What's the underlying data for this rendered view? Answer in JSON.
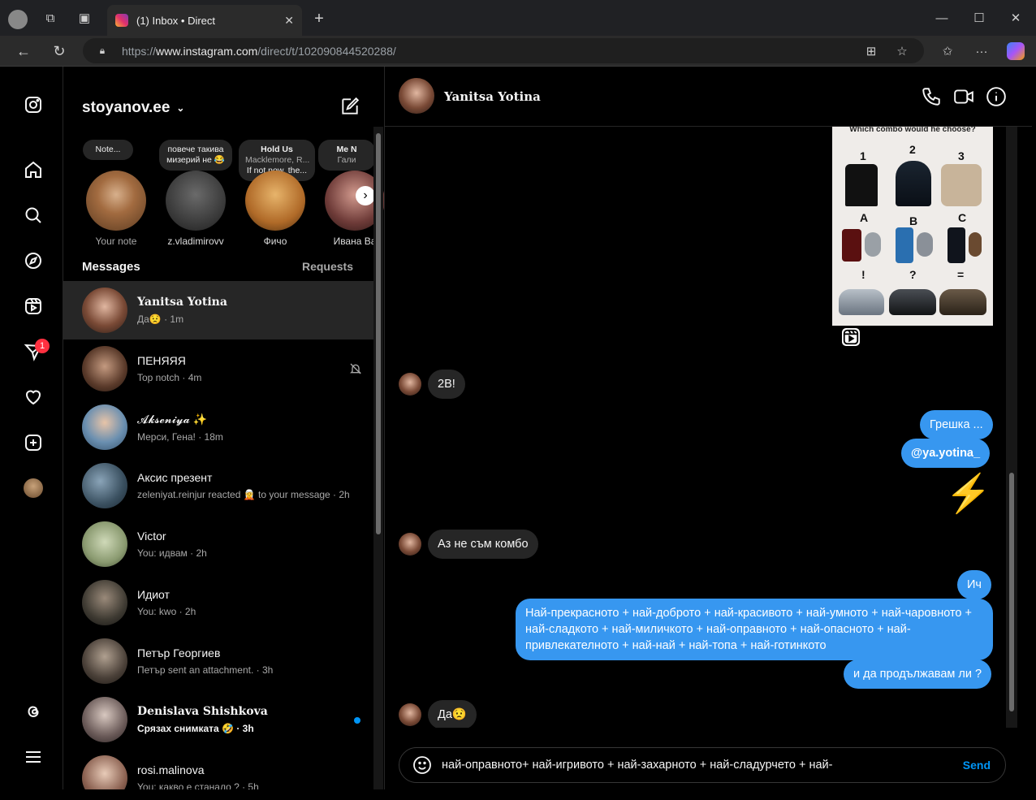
{
  "browser": {
    "tab_title": "(1) Inbox • Direct",
    "url_prefix": "https://",
    "url_host": "www.instagram.com",
    "url_path": "/direct/t/102090844520288/"
  },
  "rail": {
    "notification_badge": "1"
  },
  "inbox": {
    "account": "stoyanov.ee",
    "notes": [
      {
        "bubble": "Note...",
        "name": "Your note"
      },
      {
        "bubble": "повече такива мизерий не 😂",
        "name": "z.vladimirovv"
      },
      {
        "bubble": "Hold Us If not now, the...",
        "song": "Hold Us",
        "artist": "Macklemore, R...",
        "text": "If not now, the...",
        "name": "Фичо"
      },
      {
        "bubble": "Me N Гали",
        "song": "Me N",
        "artist": "Гали",
        "name": "Ивана Ва"
      }
    ],
    "messages_label": "Messages",
    "requests_label": "Requests",
    "conversations": [
      {
        "name": "Yanitsa Yotina",
        "preview": "Да😟 · 1m"
      },
      {
        "name": "ПЕНЯЯЯ",
        "preview": "Top notch · 4m"
      },
      {
        "name": "𝓐𝓴𝓼𝓮𝓷𝓲𝔂𝓪 ✨",
        "preview": "Мерси, Гена! · 18m"
      },
      {
        "name": "Аксис презент",
        "preview": "zeleniyat.reinjur reacted 🧝 to your message · 2h"
      },
      {
        "name": "Victor",
        "preview": "You: идвам · 2h"
      },
      {
        "name": "Идиот",
        "preview": "You: kwo · 2h"
      },
      {
        "name": "Петър Георгиев",
        "preview": "Петър sent an attachment. · 3h"
      },
      {
        "name": "Denislava Shishkova",
        "preview": "Срязах снимката 🤣 · 3h"
      },
      {
        "name": "rosi.malinova",
        "preview": "You: какво е станало ? · 5h"
      }
    ]
  },
  "chat": {
    "contact_name": "Yanitsa Yotina",
    "image_caption": "Which combo would he choose?",
    "image_labels": [
      "1",
      "2",
      "3",
      "A",
      "B",
      "C",
      "!",
      "?",
      "="
    ],
    "messages": [
      {
        "from": "them",
        "text": "2B!"
      },
      {
        "from": "me",
        "text": "Грешка ..."
      },
      {
        "from": "me",
        "text": "@ya.yotina_"
      },
      {
        "from": "me",
        "text": "⚡"
      },
      {
        "from": "them",
        "text": "Аз не съм комбо"
      },
      {
        "from": "me",
        "text": "Ич"
      },
      {
        "from": "me",
        "text": "Най-прекрасното + най-доброто + най-красивото + най-умното + най-чаровното + най-сладкото + най-миличкото + най-оправното + най-опасното + най-привлекателното + най-най + най-топа + най-готинкото"
      },
      {
        "from": "me",
        "text": "и да продължавам ли ?"
      },
      {
        "from": "them",
        "text": "Да😟"
      }
    ],
    "composer_text": "най-оправното+ най-игривото + най-захарното + най-сладурчето + най-",
    "send_label": "Send"
  }
}
